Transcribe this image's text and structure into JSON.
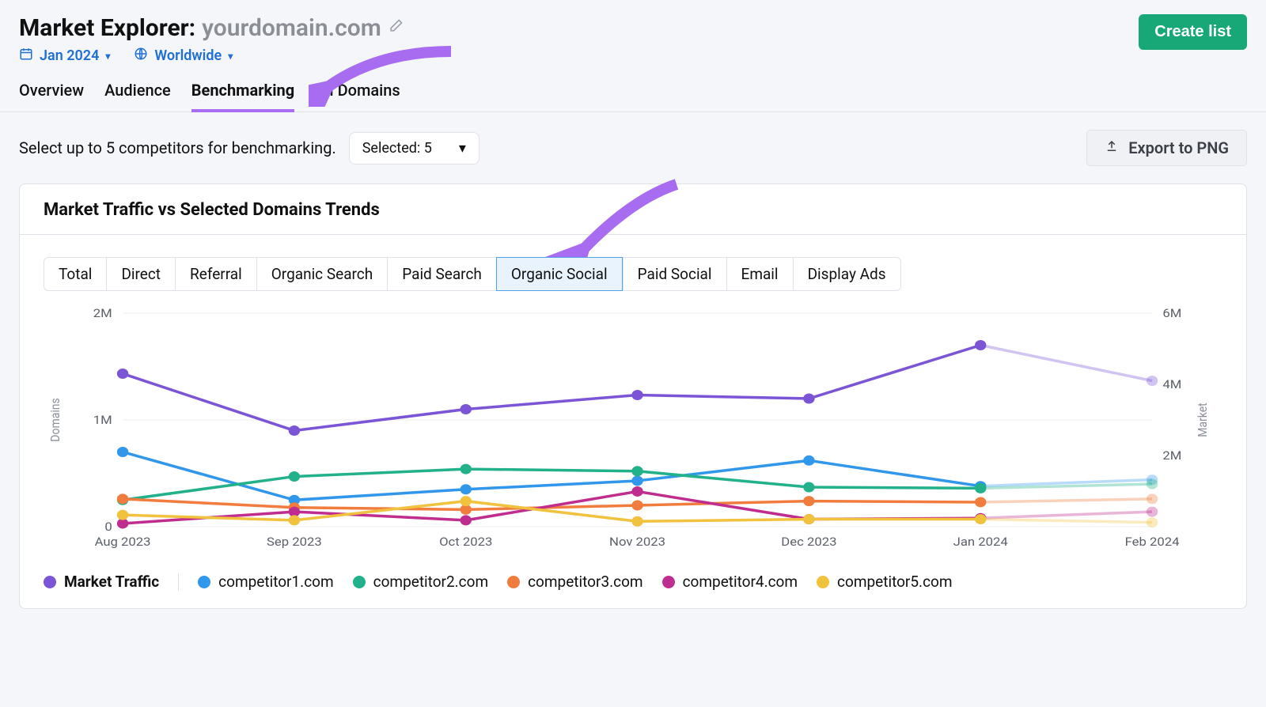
{
  "header": {
    "title_prefix": "Market Explorer:",
    "domain": "yourdomain.com",
    "date_label": "Jan 2024",
    "region_label": "Worldwide",
    "create_list": "Create list"
  },
  "tabs": [
    "Overview",
    "Audience",
    "Benchmarking",
    "All Domains"
  ],
  "tabs_active": "Benchmarking",
  "controls": {
    "prompt": "Select up to 5 competitors for benchmarking.",
    "dropdown_label": "Selected: 5",
    "export_label": "Export to PNG"
  },
  "card": {
    "title": "Market Traffic vs Selected Domains Trends",
    "pills": [
      "Total",
      "Direct",
      "Referral",
      "Organic Search",
      "Paid Search",
      "Organic Social",
      "Paid Social",
      "Email",
      "Display Ads"
    ],
    "pill_active": "Organic Social"
  },
  "legend": [
    {
      "label": "Market Traffic",
      "color": "#7b55d6",
      "bold": true,
      "sep_after": true
    },
    {
      "label": "competitor1.com",
      "color": "#3197ea"
    },
    {
      "label": "competitor2.com",
      "color": "#22b18a"
    },
    {
      "label": "competitor3.com",
      "color": "#f07d3e"
    },
    {
      "label": "competitor4.com",
      "color": "#bf2e8e"
    },
    {
      "label": "competitor5.com",
      "color": "#f0c23e"
    }
  ],
  "chart_data": {
    "type": "line",
    "x": [
      "Aug 2023",
      "Sep 2023",
      "Oct 2023",
      "Nov 2023",
      "Dec 2023",
      "Jan 2024",
      "Feb 2024"
    ],
    "xlabel": "",
    "left_axis": {
      "label": "Domains",
      "ticks": [
        0,
        "1M",
        "2M"
      ],
      "ylim": [
        0,
        2000000
      ]
    },
    "right_axis": {
      "label": "Market",
      "ticks": [
        0,
        "2M",
        "4M",
        "6M"
      ],
      "ylim": [
        0,
        6000000
      ]
    },
    "series": [
      {
        "name": "Market Traffic",
        "axis": "right",
        "color": "#7b55d6",
        "values": [
          4300000,
          2700000,
          3300000,
          3700000,
          3600000,
          5100000,
          4100000
        ],
        "faded_from": 6
      },
      {
        "name": "competitor1.com",
        "axis": "left",
        "color": "#3197ea",
        "values": [
          700000,
          250000,
          350000,
          430000,
          620000,
          380000,
          440000
        ],
        "faded_from": 6
      },
      {
        "name": "competitor2.com",
        "axis": "left",
        "color": "#22b18a",
        "values": [
          250000,
          470000,
          540000,
          520000,
          370000,
          360000,
          400000
        ],
        "faded_from": 6
      },
      {
        "name": "competitor3.com",
        "axis": "left",
        "color": "#f07d3e",
        "values": [
          260000,
          180000,
          160000,
          200000,
          240000,
          230000,
          260000
        ],
        "faded_from": 6
      },
      {
        "name": "competitor4.com",
        "axis": "left",
        "color": "#bf2e8e",
        "values": [
          30000,
          140000,
          60000,
          330000,
          70000,
          80000,
          140000
        ],
        "faded_from": 6
      },
      {
        "name": "competitor5.com",
        "axis": "left",
        "color": "#f0c23e",
        "values": [
          110000,
          60000,
          240000,
          50000,
          70000,
          70000,
          40000
        ],
        "faded_from": 6
      }
    ]
  }
}
